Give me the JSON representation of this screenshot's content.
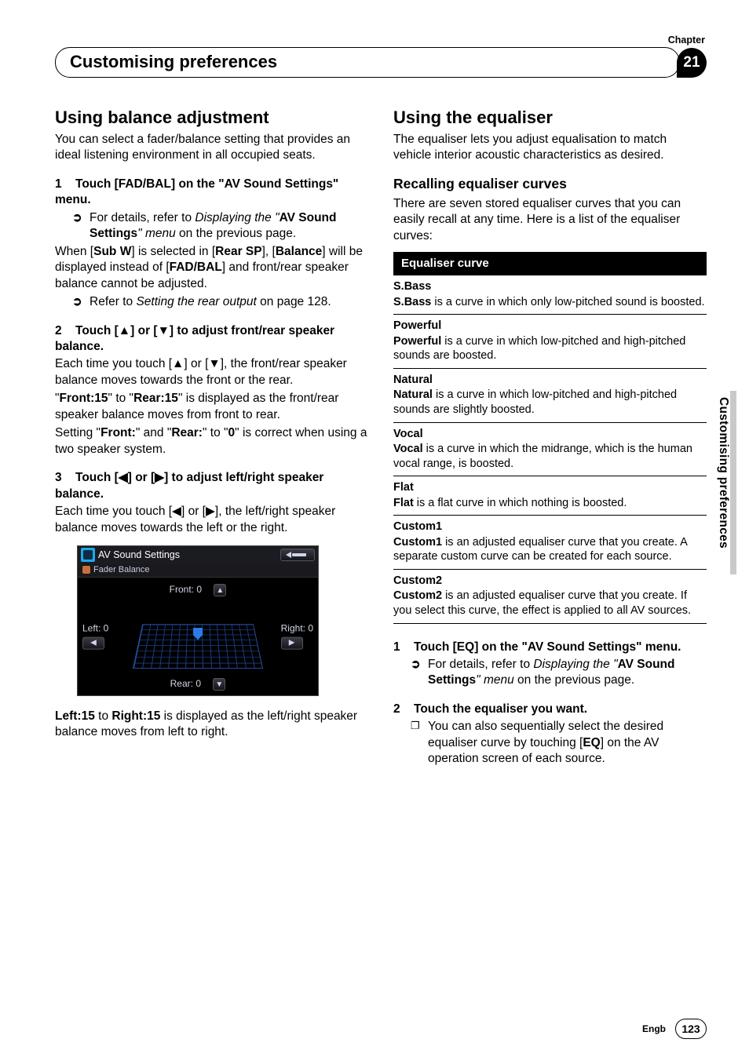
{
  "header": {
    "chapter_label": "Chapter",
    "section_title": "Customising preferences",
    "chapter_number": "21"
  },
  "side_tab": "Customising preferences",
  "footer": {
    "lang": "Engb",
    "page": "123"
  },
  "left": {
    "h2": "Using balance adjustment",
    "intro": "You can select a fader/balance setting that provides an ideal listening environment in all occupied seats.",
    "step1_head_prefix": "1",
    "step1_head": "Touch [FAD/BAL] on the \"AV Sound Settings\" menu.",
    "step1_ref_a": "For details, refer to ",
    "step1_ref_b": "Displaying the ",
    "step1_ref_c": "\"",
    "step1_ref_d": "AV Sound Settings",
    "step1_ref_e": "\" menu",
    "step1_ref_f": " on the previous page.",
    "step1_p1_a": "When [",
    "step1_p1_b": "Sub W",
    "step1_p1_c": "] is selected in [",
    "step1_p1_d": "Rear SP",
    "step1_p1_e": "], [",
    "step1_p1_f": "Balance",
    "step1_p1_g": "] will be displayed instead of [",
    "step1_p1_h": "FAD/BAL",
    "step1_p1_i": "] and front/rear speaker balance cannot be adjusted.",
    "step1_ref2_a": "Refer to ",
    "step1_ref2_b": "Setting the rear output",
    "step1_ref2_c": " on page 128.",
    "step2_head_prefix": "2",
    "step2_head": "Touch [▲] or [▼] to adjust front/rear speaker balance.",
    "step2_p1": "Each time you touch [▲] or [▼], the front/rear speaker balance moves towards the front or the rear.",
    "step2_p2_a": "\"",
    "step2_p2_b": "Front:15",
    "step2_p2_c": "\" to \"",
    "step2_p2_d": "Rear:15",
    "step2_p2_e": "\" is displayed as the front/rear speaker balance moves from front to rear.",
    "step2_p3_a": "Setting \"",
    "step2_p3_b": "Front:",
    "step2_p3_c": "\" and \"",
    "step2_p3_d": "Rear:",
    "step2_p3_e": "\" to \"",
    "step2_p3_f": "0",
    "step2_p3_g": "\" is correct when using a two speaker system.",
    "step3_head_prefix": "3",
    "step3_head": "Touch [◀] or [▶] to adjust left/right speaker balance.",
    "step3_p1": "Each time you touch [◀] or [▶], the left/right speaker balance moves towards the left or the right.",
    "img": {
      "title": "AV Sound Settings",
      "sub": "Fader Balance",
      "front": "Front:  0",
      "rear": "Rear:  0",
      "left": "Left:  0",
      "right": "Right:  0"
    },
    "after_img_a": "Left:15",
    "after_img_b": " to ",
    "after_img_c": "Right:15",
    "after_img_d": " is displayed as the left/right speaker balance moves from left to right."
  },
  "right": {
    "h2": "Using the equaliser",
    "intro": "The equaliser lets you adjust equalisation to match vehicle interior acoustic characteristics as desired.",
    "h3a": "Recalling equaliser curves",
    "h3a_p": "There are seven stored equaliser curves that you can easily recall at any time. Here is a list of the equaliser curves:",
    "table_header": "Equaliser curve",
    "rows": [
      {
        "t": "S.Bass",
        "d_a": "S.Bass",
        "d_b": " is a curve in which only low-pitched sound is boosted."
      },
      {
        "t": "Powerful",
        "d_a": "Powerful",
        "d_b": " is a curve in which low-pitched and high-pitched sounds are boosted."
      },
      {
        "t": "Natural",
        "d_a": "Natural",
        "d_b": " is a curve in which low-pitched and high-pitched sounds are slightly boosted."
      },
      {
        "t": "Vocal",
        "d_a": "Vocal",
        "d_b": " is a curve in which the midrange, which is the human vocal range, is boosted."
      },
      {
        "t": "Flat",
        "d_a": "Flat",
        "d_b": " is a flat curve in which nothing is boosted."
      },
      {
        "t": "Custom1",
        "d_a": "Custom1",
        "d_b": " is an adjusted equaliser curve that you create. A separate custom curve can be created for each source."
      },
      {
        "t": "Custom2",
        "d_a": "Custom2",
        "d_b": " is an adjusted equaliser curve that you create. If you select this curve, the effect is applied to all AV sources."
      }
    ],
    "step1_num": "1",
    "step1_head": "Touch [EQ] on the \"AV Sound Settings\" menu.",
    "step1_ref_a": "For details, refer to ",
    "step1_ref_b": "Displaying the ",
    "step1_ref_c": "\"",
    "step1_ref_d": "AV Sound Settings",
    "step1_ref_e": "\" menu",
    "step1_ref_f": " on the previous page.",
    "step2_num": "2",
    "step2_head": "Touch the equaliser you want.",
    "step2_note_a": "You can also sequentially select the desired equaliser curve by touching [",
    "step2_note_b": "EQ",
    "step2_note_c": "] on the AV operation screen of each source."
  }
}
